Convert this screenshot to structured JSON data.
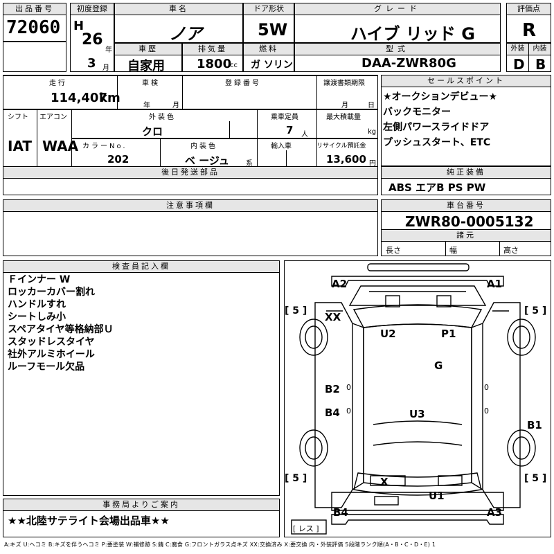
{
  "header": {
    "lot_label": "出品番号",
    "lot_number": "72060",
    "first_reg_label": "初度登録",
    "era": "H",
    "year": "26",
    "year_unit": "年",
    "month": "3",
    "month_unit": "月",
    "car_name_label": "車名",
    "car_name": "ノア",
    "door_label": "ドア形状",
    "door": "5W",
    "grade_label": "グレード",
    "grade": "ハイブ リッド G",
    "score_label": "評価点",
    "score": "R",
    "history_label": "車歴",
    "history": "自家用",
    "displacement_label": "排気量",
    "displacement": "1800",
    "displacement_unit": "cc",
    "fuel_label": "燃料",
    "fuel": "ガ ソリン",
    "model_label": "型式",
    "model": "DAA-ZWR80G",
    "exterior_label": "外装",
    "exterior": "D",
    "interior_label": "内装",
    "interior": "B"
  },
  "info": {
    "mileage_label": "走行",
    "mileage": "114,407",
    "mileage_unit": "km",
    "inspection_label": "車検",
    "inspection_year": "年",
    "inspection_month": "月",
    "reg_no_label": "登録番号",
    "transfer_label": "譲渡書類期限",
    "transfer_month": "月",
    "transfer_day": "日",
    "shift_label": "シフト",
    "shift": "IAT",
    "aircon_label": "エアコン",
    "aircon": "WAA",
    "ext_color_label": "外装色",
    "ext_color": "クロ",
    "capacity_label": "乗車定員",
    "capacity": "7",
    "capacity_unit": "人",
    "load_label": "最大積載量",
    "load_unit": "kg",
    "color_no_label": "カラーNo.",
    "color_no": "202",
    "int_color_label": "内装色",
    "int_color": "ベ ージュ",
    "int_color_unit": "系",
    "import_label": "輸入車",
    "recycle_label": "リサイクル預託金",
    "recycle": "13,600",
    "recycle_unit": "円",
    "later_parts_label": "後日発送部品"
  },
  "selling_points": {
    "label": "セールスポイント",
    "items": [
      "★オークションデビュー★",
      "バックモニター",
      "左側パワースライドドア",
      "プッシュスタート、ETC"
    ]
  },
  "equipment": {
    "label": "純正装備",
    "value": "ABS エアB PS PW"
  },
  "caution": {
    "label": "注意事項欄"
  },
  "chassis": {
    "label": "車台番号",
    "value": "ZWR80-0005132",
    "specs_label": "諸元",
    "length": "長さ",
    "width": "幅",
    "height": "高さ"
  },
  "inspector": {
    "label": "検査員記入欄",
    "notes": [
      "Ｆインナー W",
      "ロッカーカバー割れ",
      "ハンドルすれ",
      "シートしみ小",
      "スペアタイヤ等格納部Ｕ",
      "スタッドレスタイヤ",
      "社外アルミホイール",
      "ルーフモール欠品"
    ]
  },
  "office": {
    "label": "事務局よりご案内",
    "message": "★★北陸サテライト会場出品車★★"
  },
  "diagram": {
    "marks": {
      "a2": "A2",
      "a1": "A1",
      "xx": "XX",
      "u2": "U2",
      "p1": "P1",
      "g": "G",
      "b2": "B2",
      "b4_side": "B4",
      "u3": "U3",
      "b1": "B1",
      "x": "X",
      "u1": "U1",
      "b4_rear": "B4",
      "a3": "A3"
    },
    "tire_fl": "[ 5 ]",
    "tire_fr": "[ 5 ]",
    "tire_rl": "[ 5 ]",
    "tire_rr": "[ 5 ]",
    "zero": "0",
    "les": "[ レス ]"
  },
  "legend": "A:キズ U:ヘコミ B:キズを伴うヘコミ P:要塗装 W:補修跡 S:錆 C:腐食 G:フロントガラス点キズ XX:交換済み X:要交換 内・外装評価 5段階ランク順(A・B・C・D・E) 1"
}
